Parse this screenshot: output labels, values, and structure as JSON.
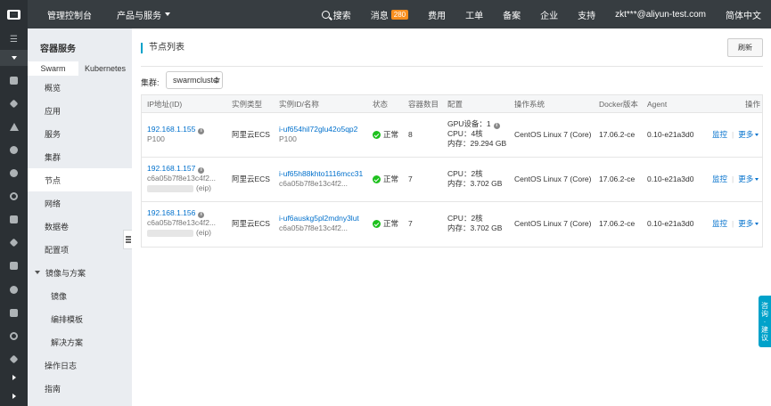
{
  "topbar": {
    "console": "管理控制台",
    "products": "产品与服务",
    "search": "搜索",
    "messages": "消息",
    "messages_badge": "280",
    "billing": "费用",
    "tickets": "工单",
    "icp": "备案",
    "enterprise": "企业",
    "support": "支持",
    "account": "zkt***@aliyun-test.com",
    "language": "简体中文"
  },
  "sidebar": {
    "title": "容器服务",
    "tabs": [
      "Swarm",
      "Kubernetes"
    ],
    "items": [
      "概览",
      "应用",
      "服务",
      "集群",
      "节点",
      "网络",
      "数据卷",
      "配置项"
    ],
    "group": "镜像与方案",
    "sub_items": [
      "镜像",
      "编排模板",
      "解决方案"
    ],
    "bottom_items": [
      "操作日志",
      "指南"
    ]
  },
  "main": {
    "title": "节点列表",
    "refresh": "刷新",
    "cluster_label": "集群:",
    "cluster_value": "swarmcluster",
    "columns": [
      "IP地址(ID)",
      "实例类型",
      "实例ID/名称",
      "状态",
      "容器数目",
      "配置",
      "操作系统",
      "Docker版本",
      "Agent",
      "操作"
    ],
    "rows": [
      {
        "ip": "192.168.1.155",
        "sub": "P100",
        "eip": "",
        "type": "阿里云ECS",
        "instance_id": "i-uf654hil72glu42o5qp2",
        "instance_name": "P100",
        "status": "正常",
        "containers": "8",
        "config": [
          "GPU设备：1",
          "CPU：4核",
          "内存：29.294 GB"
        ],
        "os": "CentOS Linux 7 (Core)",
        "docker": "17.06.2-ce",
        "agent": "0.10-e21a3d0",
        "monitor": "监控",
        "more": "更多"
      },
      {
        "ip": "192.168.1.157",
        "sub": "c6a05b7f8e13c4f2...",
        "eip": "(eip)",
        "type": "阿里云ECS",
        "instance_id": "i-uf65h88khto1116mcc31",
        "instance_name": "c6a05b7f8e13c4f2...",
        "status": "正常",
        "containers": "7",
        "config": [
          "CPU：2核",
          "内存：3.702 GB"
        ],
        "os": "CentOS Linux 7 (Core)",
        "docker": "17.06.2-ce",
        "agent": "0.10-e21a3d0",
        "monitor": "监控",
        "more": "更多"
      },
      {
        "ip": "192.168.1.156",
        "sub": "c6a05b7f8e13c4f2...",
        "eip": "(eip)",
        "type": "阿里云ECS",
        "instance_id": "i-uf6auskg5pl2mdny3lut",
        "instance_name": "c6a05b7f8e13c4f2...",
        "status": "正常",
        "containers": "7",
        "config": [
          "CPU：2核",
          "内存：3.702 GB"
        ],
        "os": "CentOS Linux 7 (Core)",
        "docker": "17.06.2-ce",
        "agent": "0.10-e21a3d0",
        "monitor": "监控",
        "more": "更多"
      }
    ]
  },
  "feedback": [
    "咨",
    "询",
    "·",
    "建",
    "议"
  ],
  "colors": {
    "topbar": "#373d41",
    "accent": "#00a2ca",
    "link": "#0070cc",
    "status_ok": "#1dc11d",
    "badge": "#f98e1e"
  }
}
